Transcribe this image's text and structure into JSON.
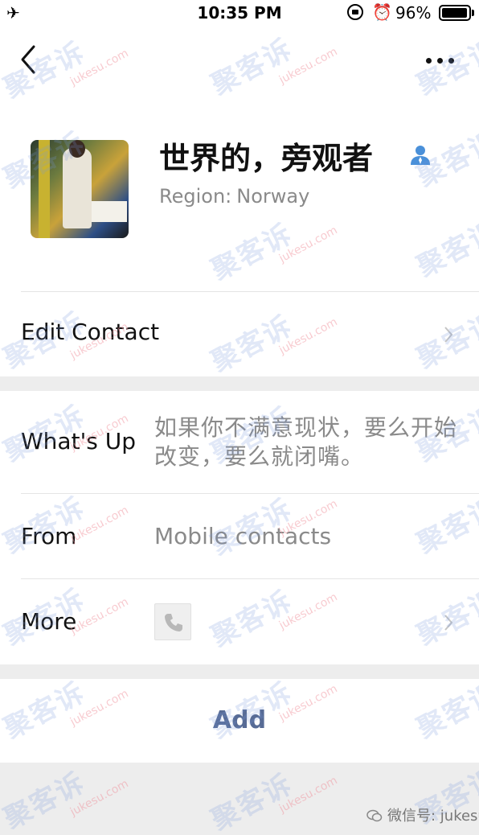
{
  "status_bar": {
    "time": "10:35 PM",
    "battery": "96%",
    "battery_level": 0.96
  },
  "profile": {
    "nickname": "世界的，旁观者",
    "region_label": "Region:",
    "region_value": "Norway"
  },
  "actions": {
    "edit_contact": "Edit Contact",
    "add": "Add"
  },
  "details": {
    "whats_up_label": "What's Up",
    "whats_up_value": "如果你不满意现状，要么开始改变，要么就闭嘴。",
    "from_label": "From",
    "from_value": "Mobile contacts",
    "more_label": "More"
  },
  "watermark": {
    "brand_cn": "聚客诉",
    "brand_en": "jukesu.com",
    "account": "微信号: jukesu"
  },
  "colors": {
    "link_blue": "#576b95",
    "secondary_text": "#8a8a8a",
    "background": "#ededed"
  }
}
